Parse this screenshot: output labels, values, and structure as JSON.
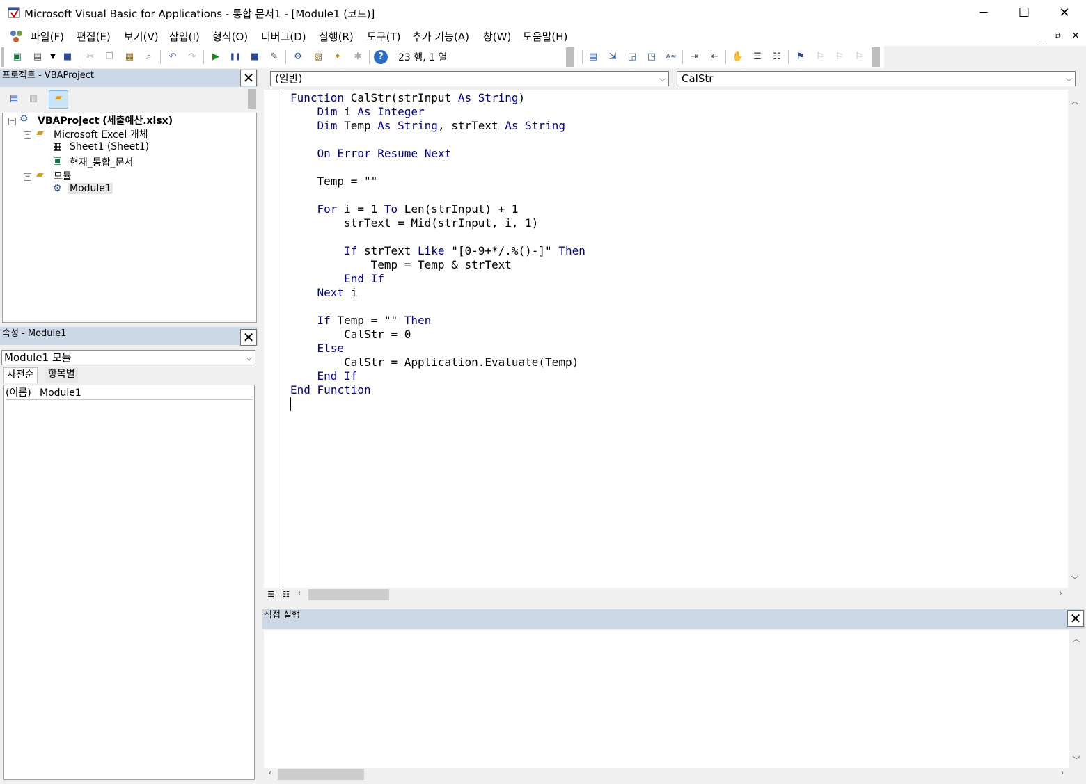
{
  "window": {
    "title": "Microsoft Visual Basic for Applications - 통합 문서1 - [Module1 (코드)]",
    "minimize": "─",
    "maximize": "☐",
    "close": "✕"
  },
  "menu": [
    "파일(F)",
    "편집(E)",
    "보기(V)",
    "삽입(I)",
    "형식(O)",
    "디버그(D)",
    "실행(R)",
    "도구(T)",
    "추가 기능(A)",
    "창(W)",
    "도움말(H)"
  ],
  "mdi": {
    "minimize": "_",
    "restore": "⧉",
    "close": "✕"
  },
  "toolbar": {
    "position": "23 행, 1 열"
  },
  "project": {
    "title": "프로젝트 - VBAProject",
    "tree": {
      "root": "VBAProject (세출예산.xlsx)",
      "excel_objects": "Microsoft Excel 개체",
      "sheet1": "Sheet1 (Sheet1)",
      "thisworkbook": "현재_통합_문서",
      "modules": "모듈",
      "module1": "Module1"
    }
  },
  "properties": {
    "title": "속성 - Module1",
    "combo": "Module1 모듈",
    "tabs": [
      "사전순",
      "항목별"
    ],
    "rows": [
      {
        "name": "(이름)",
        "value": "Module1"
      }
    ]
  },
  "code": {
    "object_combo": "(일반)",
    "procedure_combo": "CalStr",
    "lines": [
      "Function CalStr(strInput As String)",
      "    Dim i As Integer",
      "    Dim Temp As String, strText As String",
      "",
      "    On Error Resume Next",
      "",
      "    Temp = \"\"",
      "",
      "    For i = 1 To Len(strInput) + 1",
      "        strText = Mid(strInput, i, 1)",
      "",
      "        If strText Like \"[0-9+*/.%()-]\" Then",
      "            Temp = Temp & strText",
      "        End If",
      "    Next i",
      "",
      "    If Temp = \"\" Then",
      "        CalStr = 0",
      "    Else",
      "        CalStr = Application.Evaluate(Temp)",
      "    End If",
      "End Function"
    ]
  },
  "immediate": {
    "title": "직접 실행"
  },
  "colors": {
    "keyword": "#00008b",
    "pane_header": "#cdd8e6"
  }
}
